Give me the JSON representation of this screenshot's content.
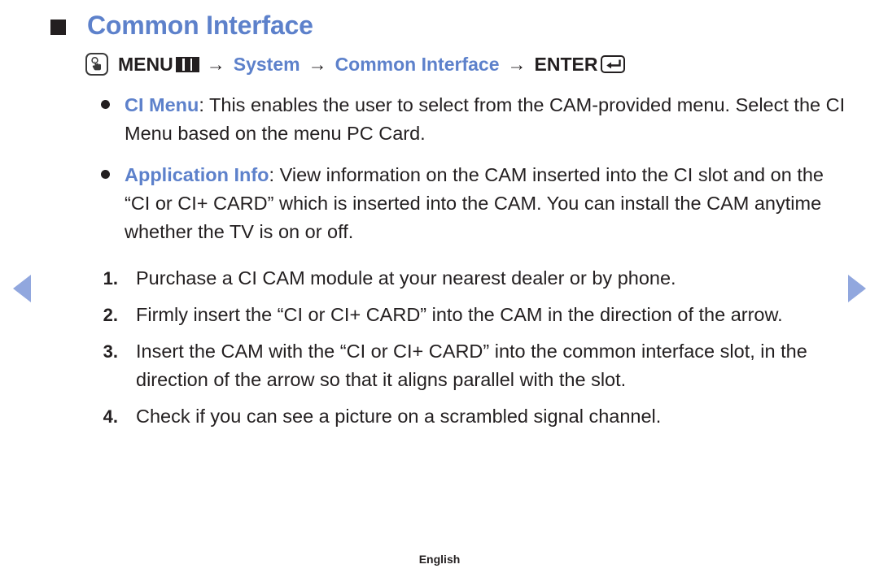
{
  "heading": {
    "bullet_icon": "filled-square-bullet",
    "title": "Common Interface",
    "color": "#5d81cb"
  },
  "menu_path": {
    "touch_icon": "hand-press-icon",
    "menu_label": "MENU",
    "menu_icon": "menu-bars-icon",
    "arrow": "→",
    "item1": "System",
    "item2": "Common Interface",
    "enter_label": "ENTER",
    "enter_icon": "enter-return-icon",
    "blue_color": "#5d81cb",
    "text_color": "#231f20"
  },
  "bullets": [
    {
      "dot_icon": "round-bullet",
      "term": "CI Menu",
      "text": ": This enables the user to select from the CAM-provided menu. Select the CI Menu based on the menu PC Card."
    },
    {
      "dot_icon": "round-bullet",
      "term": "Application Info",
      "text": ": View information on the CAM inserted into the CI slot and on the “CI or CI+ CARD” which is inserted into the CAM. You can install the CAM anytime whether the TV is on or off."
    }
  ],
  "steps": [
    {
      "number": "1.",
      "text": "Purchase a CI CAM module at your nearest dealer or by phone."
    },
    {
      "number": "2.",
      "text": "Firmly insert the “CI or CI+ CARD” into the CAM in the direction of the arrow."
    },
    {
      "number": "3.",
      "text": "Insert the CAM with the “CI or CI+ CARD” into the common interface slot, in the direction of the arrow so that it aligns parallel with the slot."
    },
    {
      "number": "4.",
      "text": "Check if you can see a picture on a scrambled signal channel."
    }
  ],
  "navigation": {
    "prev_icon": "triangle-left-icon",
    "next_icon": "triangle-right-icon",
    "arrow_color": "#91a7de"
  },
  "footer": {
    "language": "English"
  }
}
